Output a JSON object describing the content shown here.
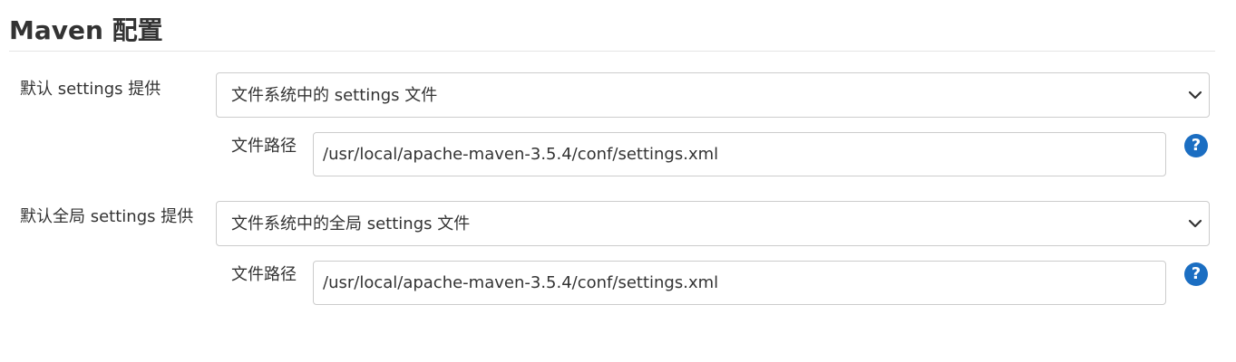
{
  "section": {
    "title": "Maven 配置"
  },
  "settings": {
    "label": "默认 settings 提供",
    "selected": "文件系统中的 settings 文件",
    "path_label": "文件路径",
    "path_value": "/usr/local/apache-maven-3.5.4/conf/settings.xml"
  },
  "global_settings": {
    "label": "默认全局 settings 提供",
    "selected": "文件系统中的全局 settings 文件",
    "path_label": "文件路径",
    "path_value": "/usr/local/apache-maven-3.5.4/conf/settings.xml"
  },
  "help": {
    "glyph": "?"
  },
  "icons": {
    "help": "help-question-icon",
    "dropdown": "chevron-down-icon"
  },
  "colors": {
    "help_icon": "#1b6ec2",
    "border": "#cccccc",
    "text": "#333333"
  }
}
